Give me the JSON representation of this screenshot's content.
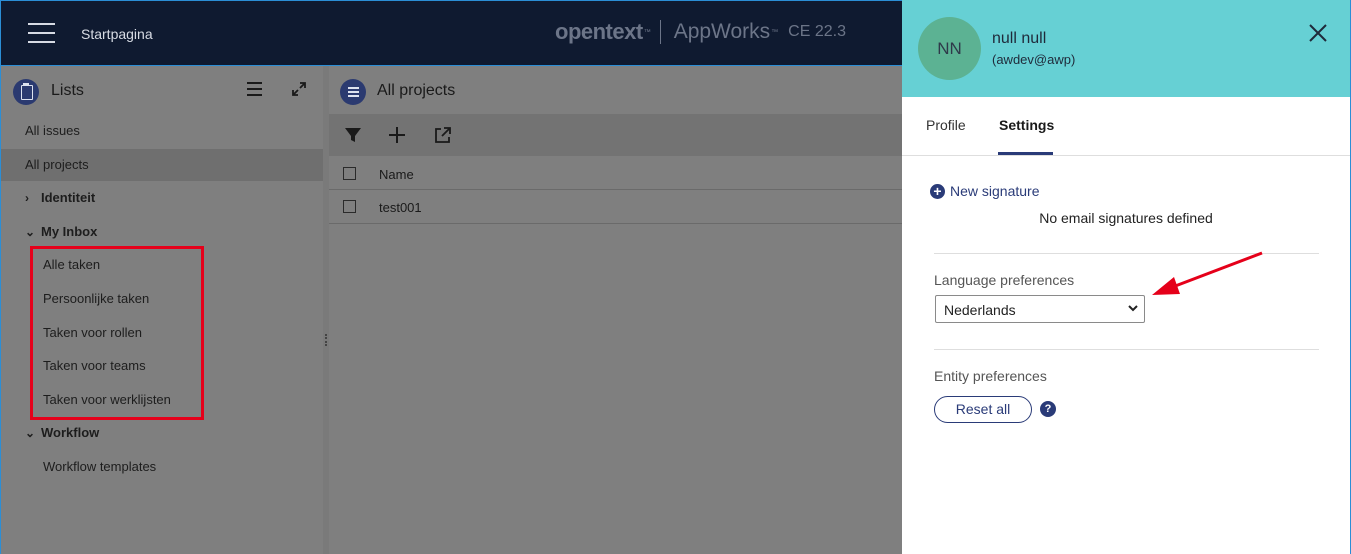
{
  "header": {
    "title": "Startpagina",
    "brand_name": "opentext",
    "brand_product": "AppWorks",
    "brand_version": "CE 22.3"
  },
  "lists_panel": {
    "title": "Lists",
    "items": [
      {
        "label": "All issues"
      },
      {
        "label": "All projects",
        "active": true
      }
    ],
    "groups": [
      {
        "label": "Identiteit",
        "expanded": false,
        "items": []
      },
      {
        "label": "My Inbox",
        "expanded": true,
        "items": [
          {
            "label": "Alle taken"
          },
          {
            "label": "Persoonlijke taken"
          },
          {
            "label": "Taken voor rollen"
          },
          {
            "label": "Taken voor teams"
          },
          {
            "label": "Taken voor werklijsten"
          }
        ]
      },
      {
        "label": "Workflow",
        "expanded": true,
        "items": [
          {
            "label": "Workflow templates"
          }
        ]
      }
    ]
  },
  "projects_panel": {
    "title": "All projects",
    "toolbar": [
      "filter-icon",
      "add-icon",
      "open-external-icon"
    ],
    "columns": [
      "Name"
    ],
    "rows": [
      [
        "test001"
      ]
    ]
  },
  "profile": {
    "initials": "NN",
    "name": "null null",
    "user_id": "(awdev@awp)",
    "tabs": [
      {
        "label": "Profile",
        "active": false
      },
      {
        "label": "Settings",
        "active": true
      }
    ],
    "new_signature_label": "New signature",
    "no_signatures_text": "No email signatures defined",
    "language_label": "Language preferences",
    "language_value": "Nederlands",
    "entity_label": "Entity preferences",
    "reset_label": "Reset all",
    "help_label": "?"
  },
  "colors": {
    "header_bg": "#0f1a30",
    "profile_header_bg": "#66d0d4",
    "avatar_bg": "#5cb293",
    "accent": "#2a3b78",
    "highlight": "#e5001a"
  }
}
